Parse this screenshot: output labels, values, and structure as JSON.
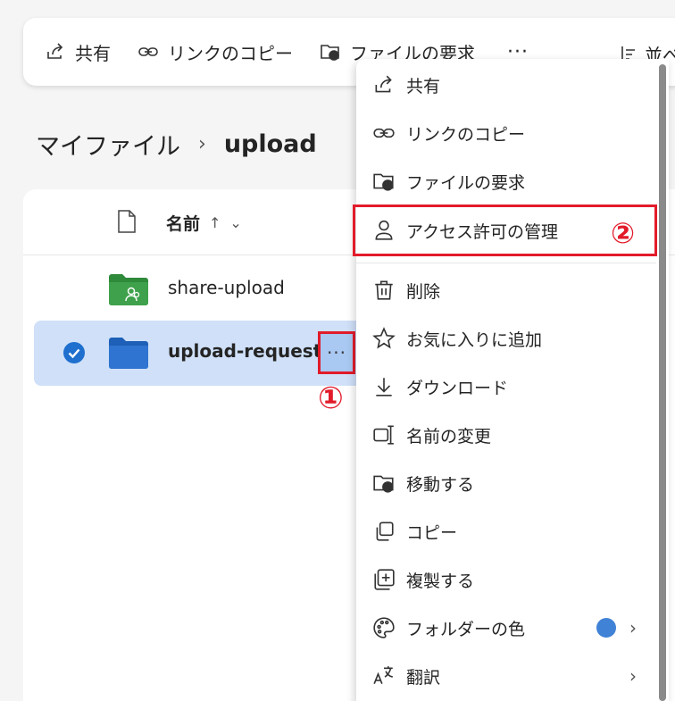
{
  "toolbar": {
    "share": "共有",
    "copy_link": "リンクのコピー",
    "request_files": "ファイルの要求",
    "more": "···",
    "sort": "並べ"
  },
  "breadcrumb": {
    "root": "マイファイル",
    "separator": "›",
    "current": "upload"
  },
  "list": {
    "header_name": "名前",
    "sort_arrow": "↑",
    "sort_chevron": "⌄",
    "rows": [
      {
        "name": "share-upload"
      },
      {
        "name": "upload-request"
      }
    ],
    "row_more": "···"
  },
  "annotations": {
    "step1": "①",
    "step2": "②"
  },
  "menu": {
    "items": [
      {
        "label": "共有",
        "icon": "share-icon"
      },
      {
        "label": "リンクのコピー",
        "icon": "link-icon"
      },
      {
        "label": "ファイルの要求",
        "icon": "folder-request-icon"
      },
      {
        "label": "アクセス許可の管理",
        "icon": "person-icon"
      },
      {
        "label": "削除",
        "icon": "trash-icon"
      },
      {
        "label": "お気に入りに追加",
        "icon": "star-icon"
      },
      {
        "label": "ダウンロード",
        "icon": "download-icon"
      },
      {
        "label": "名前の変更",
        "icon": "rename-icon"
      },
      {
        "label": "移動する",
        "icon": "move-icon"
      },
      {
        "label": "コピー",
        "icon": "copy-icon"
      },
      {
        "label": "複製する",
        "icon": "duplicate-icon"
      },
      {
        "label": "フォルダーの色",
        "icon": "palette-icon"
      },
      {
        "label": "翻訳",
        "icon": "translate-icon"
      }
    ],
    "chevron": "›"
  },
  "colors": {
    "accent": "#e21b2a",
    "selected_row": "#cfe0f8",
    "folder_blue": "#2e74d0",
    "folder_green": "#2f8a3a",
    "folder_color_dot": "#4082d6"
  }
}
